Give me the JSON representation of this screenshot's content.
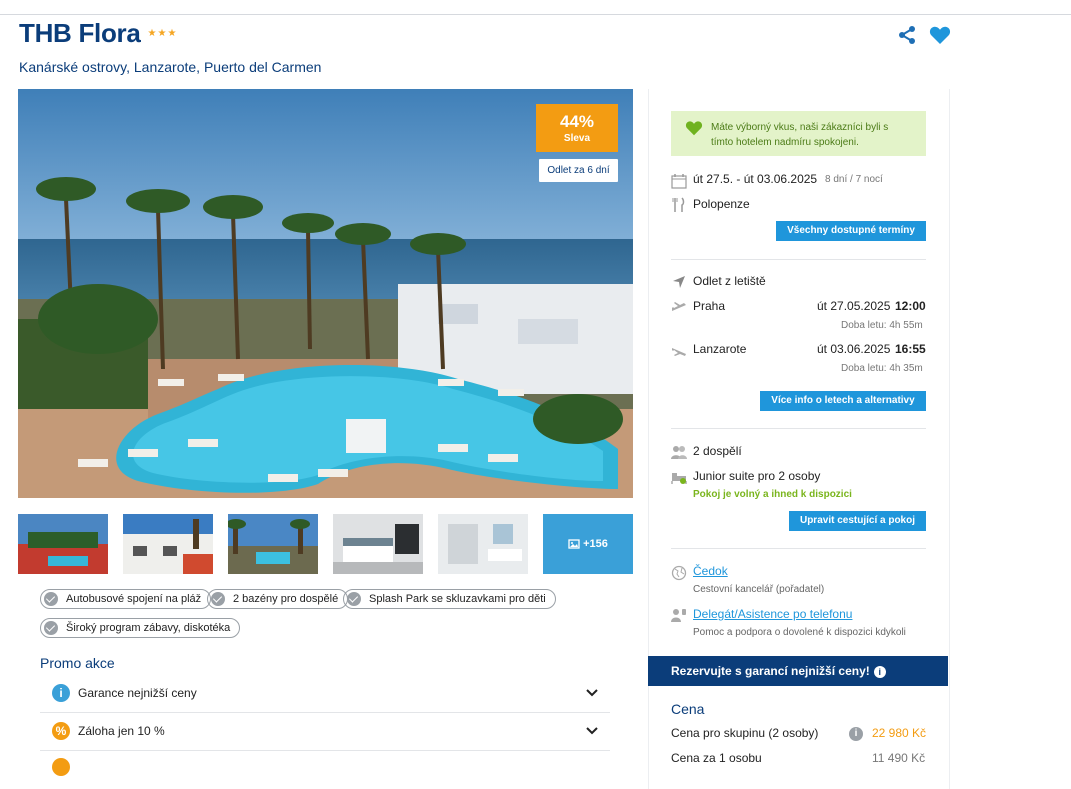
{
  "hotel": {
    "name": "THB Flora",
    "stars": "★★★",
    "location": "Kanárské ostrovy, Lanzarote, Puerto del Carmen"
  },
  "gallery": {
    "discount_pct": "44%",
    "discount_label": "Sleva",
    "departure_badge": "Odlet za 6 dní",
    "more_photos": "+156"
  },
  "tags": [
    "Autobusové spojení na pláž",
    "2 bazény pro dospělé",
    "Splash Park se skluzavkami pro děti",
    "Široký program zábavy, diskotéka"
  ],
  "promo": {
    "title": "Promo akce",
    "items": [
      {
        "label": "Garance nejnižší ceny",
        "icon": "info-icon",
        "color": "#3aa0d8"
      },
      {
        "label": "Záloha jen 10 %",
        "icon": "percent-icon",
        "color": "#f39c12"
      }
    ]
  },
  "sidebar": {
    "taste_message": "Máte výborný vkus, naši zákazníci byli s tímto hotelem nadmíru spokojeni.",
    "dates": "út 27.5. - út 03.06.2025",
    "nights": "8 dní / 7 nocí",
    "board": "Polopenze",
    "all_dates_button": "Všechny dostupné termíny",
    "departure_from": "Odlet z letiště",
    "outbound": {
      "city": "Praha",
      "date": "út 27.05.2025",
      "time": "12:00",
      "duration": "Doba letu: 4h 55m"
    },
    "inbound": {
      "city": "Lanzarote",
      "date": "út 03.06.2025",
      "time": "16:55",
      "duration": "Doba letu: 4h 35m"
    },
    "flights_button": "Více info o letech a alternativy",
    "travellers": "2 dospělí",
    "room": "Junior suite pro 2 osoby",
    "room_status": "Pokoj je volný a ihned k dispozici",
    "edit_button": "Upravit cestující a pokoj",
    "agency_name": "Čedok",
    "agency_desc": "Cestovní kancelář (pořadatel)",
    "delegate_link": "Delegát/Asistence po telefonu",
    "delegate_desc": "Pomoc a podpora o dovolené k dispozici kdykoli",
    "reserve_banner": "Rezervujte s garancí nejnižší ceny!",
    "price_title": "Cena",
    "group_price_label": "Cena pro skupinu (2 osoby)",
    "group_price": "22 980 Kč",
    "person_price_label": "Cena za 1 osobu",
    "person_price": "11 490 Kč"
  },
  "colors": {
    "brand_blue": "#0b3d7a",
    "accent_blue": "#1f96db",
    "orange": "#f39c12",
    "green": "#7ab51d"
  }
}
